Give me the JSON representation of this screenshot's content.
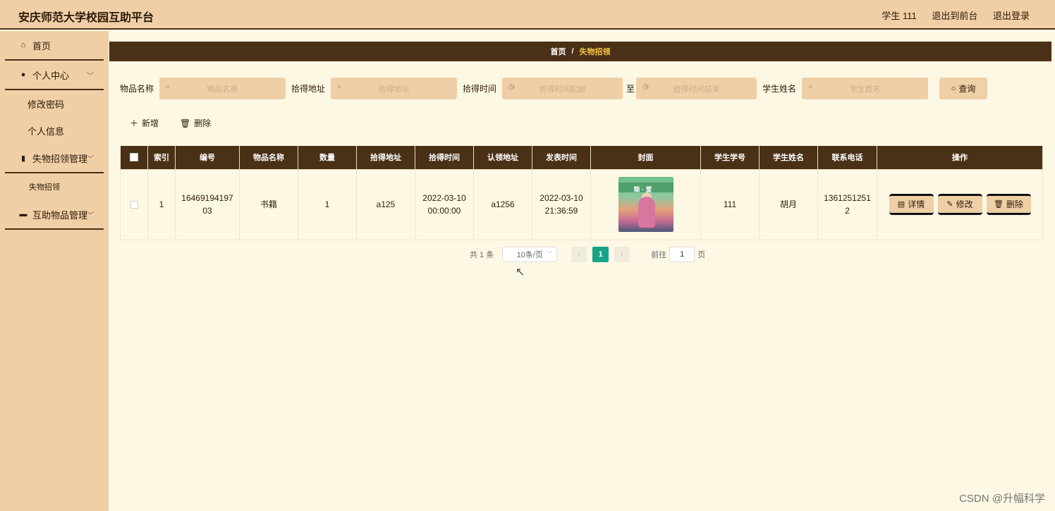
{
  "app": {
    "title": "安庆师范大学校园互助平台"
  },
  "header": {
    "user": "学生 111",
    "back_front": "退出到前台",
    "logout": "退出登录"
  },
  "sidebar": {
    "home": "首页",
    "personal": {
      "label": "个人中心",
      "items": [
        "修改密码",
        "个人信息"
      ]
    },
    "lost_mgmt": {
      "label": "失物招领管理",
      "items": [
        "失物招领"
      ]
    },
    "mutual_mgmt": {
      "label": "互助物品管理"
    }
  },
  "breadcrumb": {
    "home": "首页",
    "sep": "/",
    "current": "失物招领"
  },
  "search": {
    "item_name_label": "物品名称",
    "item_name_placeholder": "物品名称",
    "address_label": "拾得地址",
    "address_placeholder": "拾得地址",
    "time_label": "拾得时间",
    "time_start_placeholder": "拾得时间起始",
    "to": "至",
    "time_end_placeholder": "拾得时间结束",
    "student_label": "学生姓名",
    "student_placeholder": "学生姓名",
    "query_btn": "查询"
  },
  "actions": {
    "add": "新增",
    "delete": "删除"
  },
  "table": {
    "headers": [
      "",
      "索引",
      "编号",
      "物品名称",
      "数量",
      "拾得地址",
      "拾得时间",
      "认领地址",
      "发表时间",
      "封面",
      "学生学号",
      "学生姓名",
      "联系电话",
      "操作"
    ],
    "rows": [
      {
        "index": "1",
        "code": "1646919419703",
        "name": "书籍",
        "qty": "1",
        "found_addr": "a125",
        "found_time": "2022-03-10 00:00:00",
        "claim_addr": "a1256",
        "post_time": "2022-03-10 21:36:59",
        "cover_text": "简 · 爱",
        "student_id": "111",
        "student_name": "胡月",
        "phone": "13612512512",
        "ops": {
          "detail": "详情",
          "edit": "修改",
          "delete": "删除"
        }
      }
    ]
  },
  "pager": {
    "total": "共 1 条",
    "page_size": "10条/页",
    "current": "1",
    "goto_prefix": "前往",
    "goto_value": "1",
    "goto_suffix": "页"
  },
  "watermark": "CSDN @升幅科学"
}
